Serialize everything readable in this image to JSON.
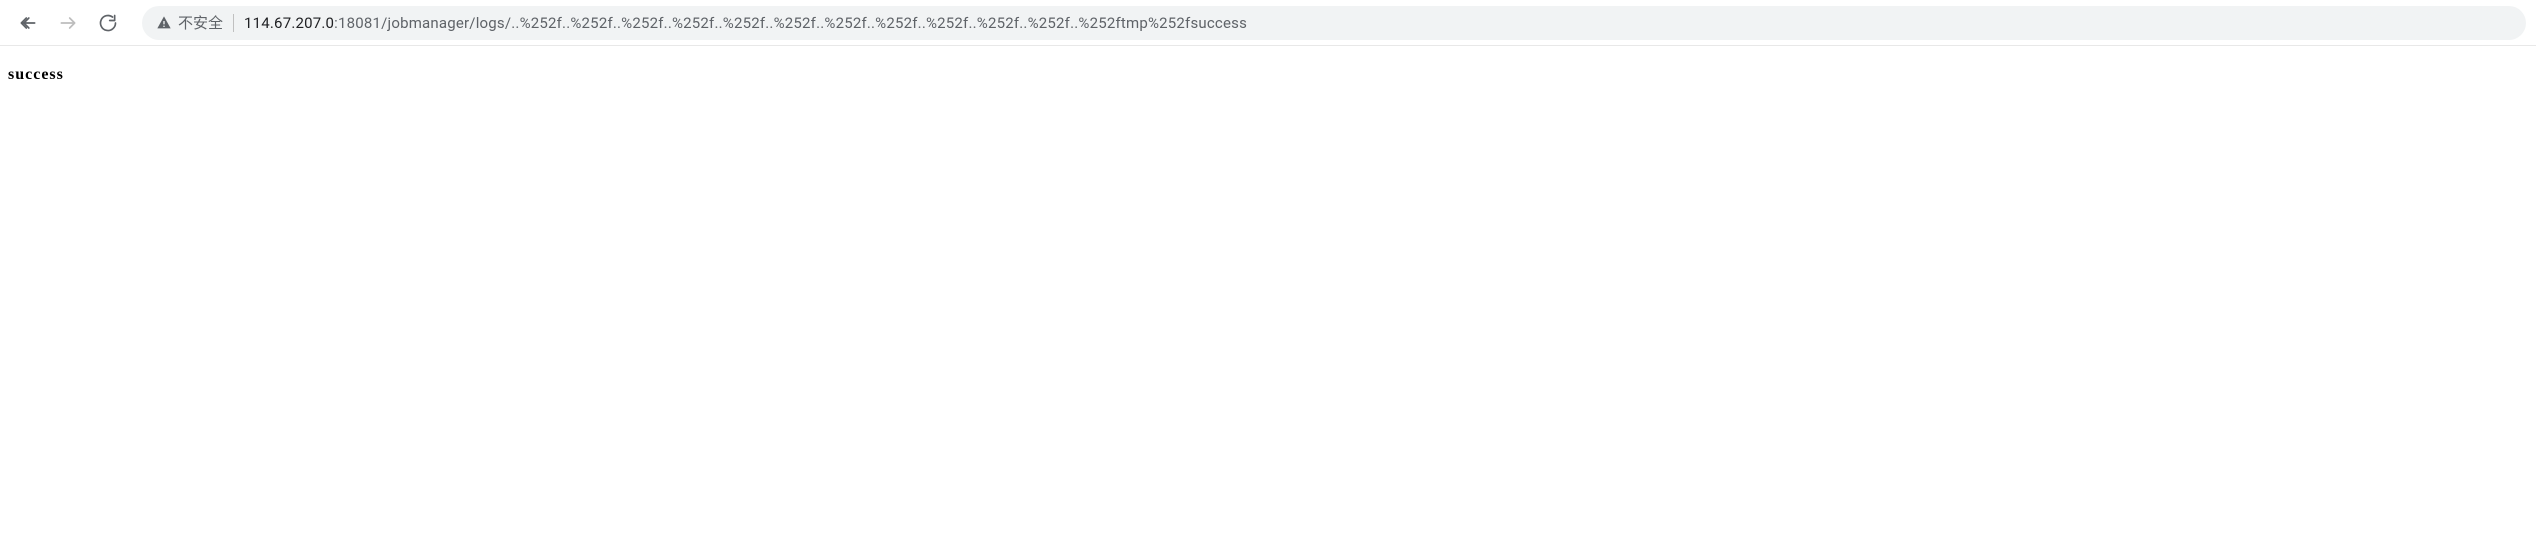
{
  "toolbar": {
    "security_label": "不安全",
    "url_host": "114.67.207.0",
    "url_path": ":18081/jobmanager/logs/..%252f..%252f..%252f..%252f..%252f..%252f..%252f..%252f..%252f..%252f..%252f..%252ftmp%252fsuccess"
  },
  "page": {
    "body_text": "success"
  }
}
